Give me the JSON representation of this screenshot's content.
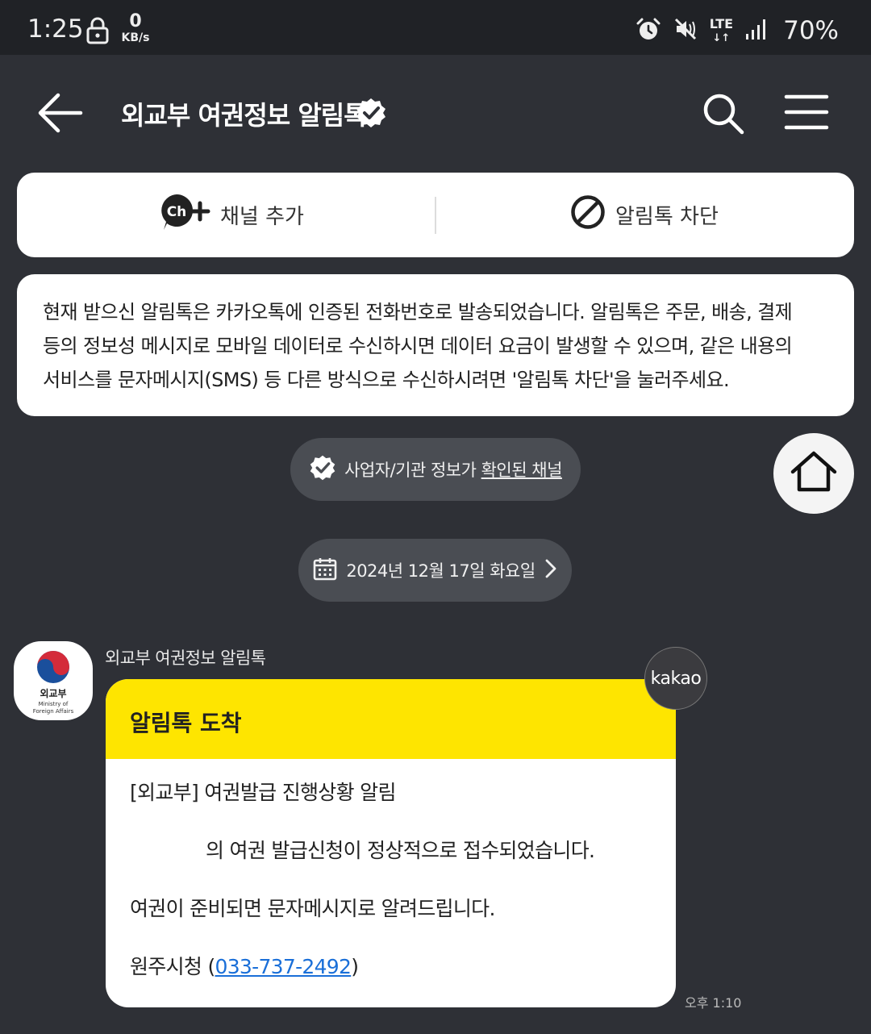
{
  "status_bar": {
    "time": "1:25",
    "net_speed_value": "0",
    "net_speed_unit": "KB/s",
    "network": "LTE",
    "battery": "70%"
  },
  "header": {
    "title": "외교부 여권정보 알림톡"
  },
  "actions": {
    "add_channel": "채널 추가",
    "block": "알림톡 차단"
  },
  "notice": "현재 받으신 알림톡은 카카오톡에 인증된 전화번호로 발송되었습니다. 알림톡은 주문, 배송, 결제 등의 정보성 메시지로 모바일 데이터로 수신하시면 데이터 요금이 발생할 수 있으며, 같은 내용의 서비스를 문자메시지(SMS) 등 다른 방식으로 수신하시려면 '알림톡 차단'을 눌러주세요.",
  "verified_pill": {
    "prefix": "사업자/기관 정보가",
    "link": "확인된 채널"
  },
  "date_pill": "2024년 12월 17일 화요일",
  "message": {
    "sender": "외교부 여권정보 알림톡",
    "avatar_org": "외교부",
    "avatar_sub_1": "Ministry of",
    "avatar_sub_2": "Foreign Affairs",
    "header": "알림톡 도착",
    "line1": "[외교부] 여권발급 진행상황 알림",
    "line2": "의 여권 발급신청이 정상적으로 접수되었습니다.",
    "line3": "여권이 준비되면 문자메시지로 알려드립니다.",
    "line4_prefix": "원주시청 (",
    "phone": "033-737-2492",
    "line4_suffix": ")",
    "badge": "kakao",
    "time": "오후 1:10"
  },
  "colors": {
    "background": "#2e3036",
    "status_bar": "#202226",
    "bubble_header": "#fee500",
    "link": "#1a6fd8"
  }
}
